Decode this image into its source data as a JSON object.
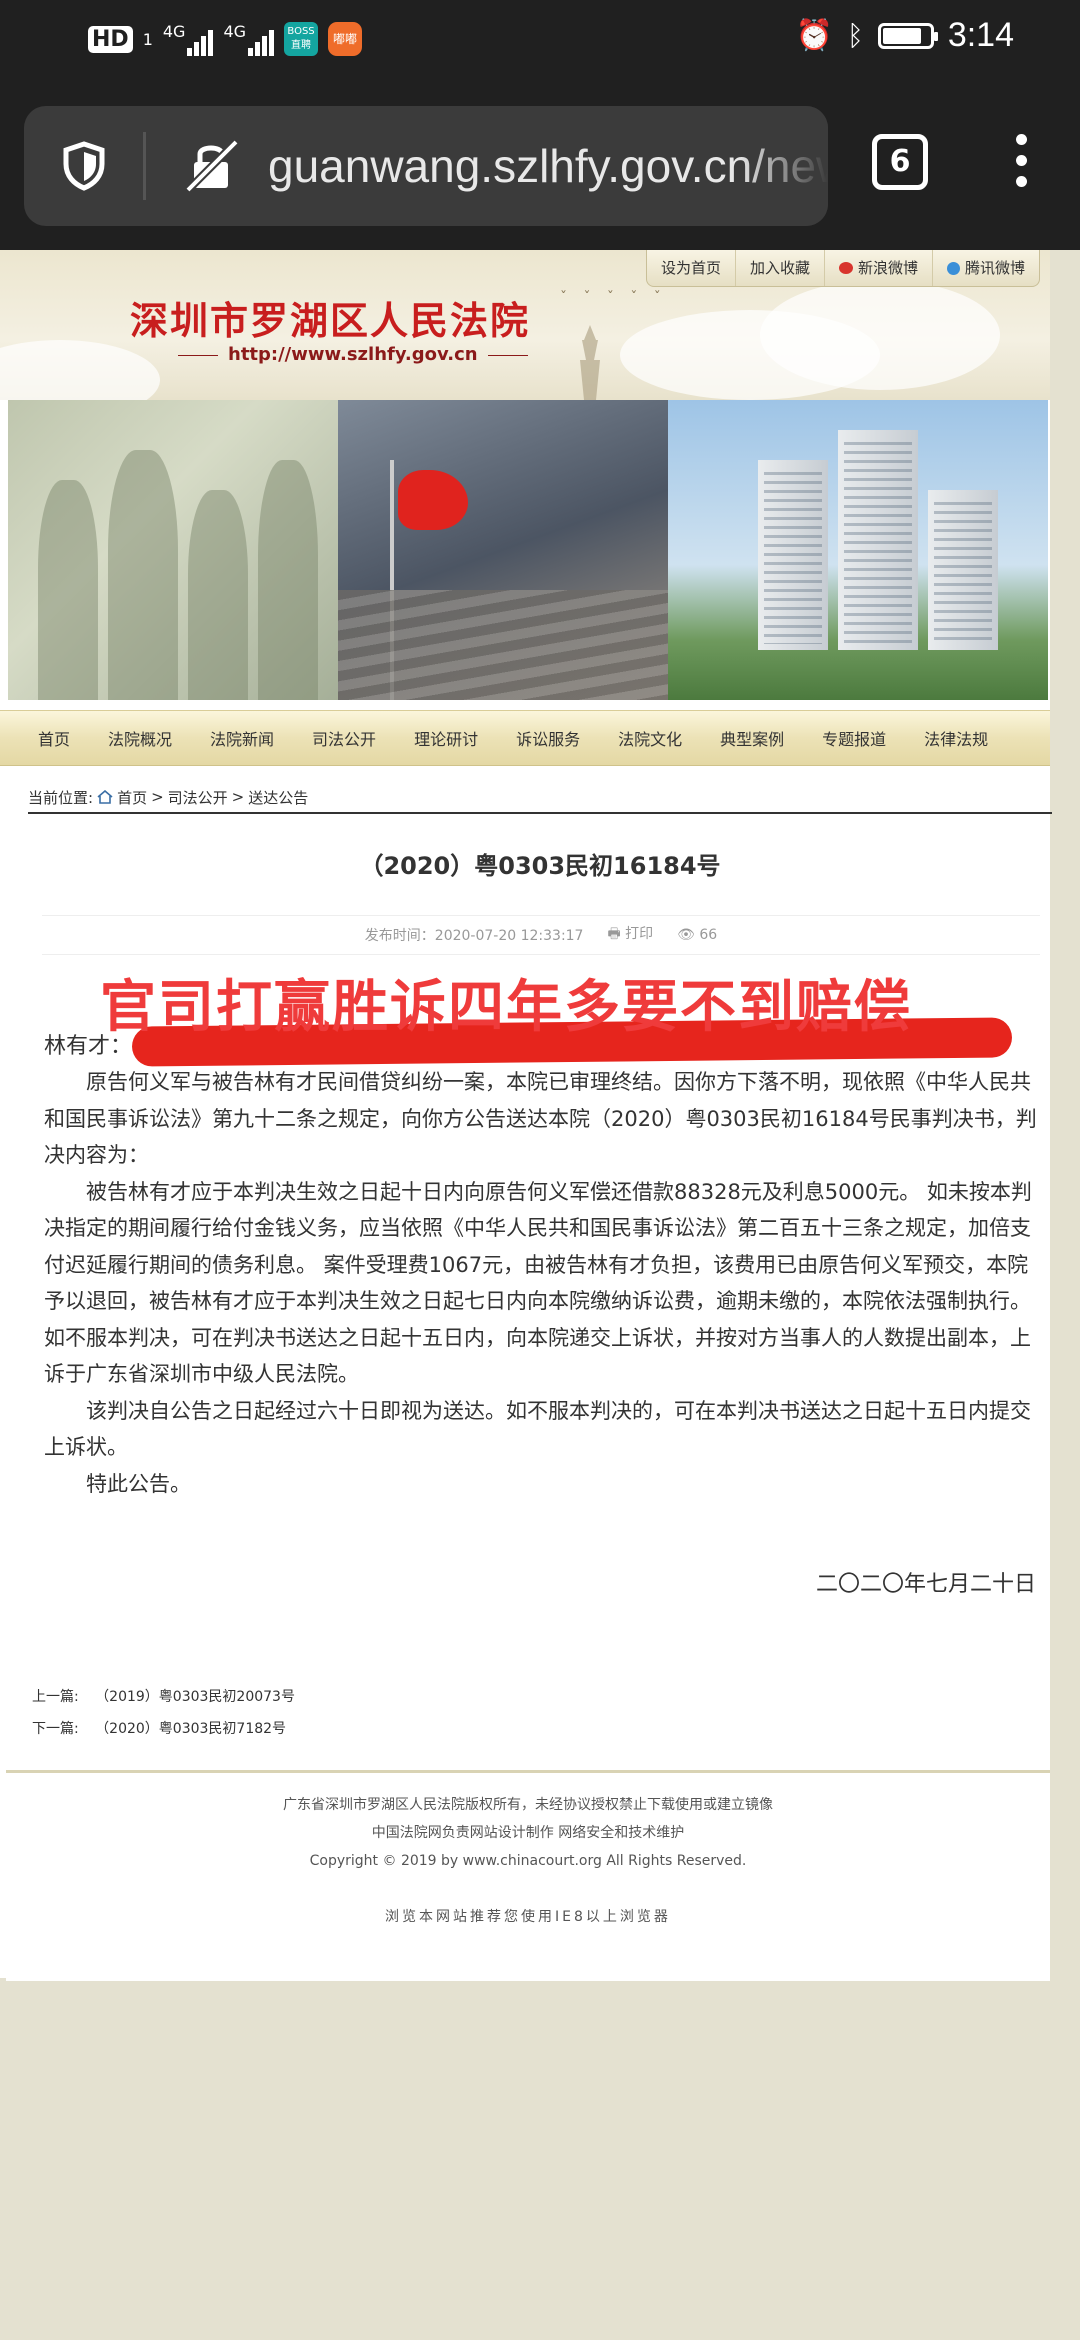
{
  "status_bar": {
    "hd_label": "HD",
    "sim1": "1",
    "net1": "4G",
    "net2": "4G",
    "app1_label": "BOSS\n直聘",
    "app2_label": "嘟嘟",
    "time": "3:14"
  },
  "browser": {
    "url": "guanwang.szlhfy.gov.cn/news",
    "tab_count": "6"
  },
  "site": {
    "top_links": [
      "设为首页",
      "加入收藏",
      "新浪微博",
      "腾讯微博"
    ],
    "court_name": "深圳市罗湖区人民法院",
    "court_url": "http://www.szlhfy.gov.cn",
    "nav": [
      "首页",
      "法院概况",
      "法院新闻",
      "司法公开",
      "理论研讨",
      "诉讼服务",
      "法院文化",
      "典型案例",
      "专题报道",
      "法律法规"
    ],
    "breadcrumb": {
      "label": "当前位置:",
      "home": "首页",
      "sep1": ">",
      "section": "司法公开",
      "sep2": ">",
      "current": "送达公告"
    }
  },
  "article": {
    "title": "（2020）粤0303民初16184号",
    "publish_time": "发布时间：2020-07-20 12:33:17",
    "print_label": "打印",
    "views": "66",
    "overlay_caption": "官司打赢胜诉四年多要不到赔偿",
    "salutation": "林有才：",
    "paragraphs": [
      "原告何义军与被告林有才民间借贷纠纷一案，本院已审理终结。因你方下落不明，现依照《中华人民共和国民事诉讼法》第九十二条之规定，向你方公告送达本院（2020）粤0303民初16184号民事判决书，判决内容为：",
      "被告林有才应于本判决生效之日起十日内向原告何义军偿还借款88328元及利息5000元。 如未按本判决指定的期间履行给付金钱义务，应当依照《中华人民共和国民事诉讼法》第二百五十三条之规定，加倍支付迟延履行期间的债务利息。 案件受理费1067元，由被告林有才负担，该费用已由原告何义军预交，本院予以退回，被告林有才应于本判决生效之日起七日内向本院缴纳诉讼费，逾期未缴的，本院依法强制执行。 如不服本判决，可在判决书送达之日起十五日内，向本院递交上诉状，并按对方当事人的人数提出副本，上诉于广东省深圳市中级人民法院。",
      "该判决自公告之日起经过六十日即视为送达。如不服本判决的，可在本判决书送达之日起十五日内提交上诉状。",
      "特此公告。"
    ],
    "date": "二〇二〇年七月二十日"
  },
  "prev_next": {
    "prev_label": "上一篇:",
    "prev_title": "（2019）粤0303民初20073号",
    "next_label": "下一篇:",
    "next_title": "（2020）粤0303民初7182号"
  },
  "footer": {
    "line1": "广东省深圳市罗湖区人民法院版权所有，未经协议授权禁止下载使用或建立镜像",
    "line2": "中国法院网负责网站设计制作 网络安全和技术维护",
    "line3": "Copyright © 2019 by www.chinacourt.org All Rights Reserved.",
    "line4": "浏览本网站推荐您使用IE8以上浏览器"
  },
  "colors": {
    "status_bg": "#202020",
    "court_red": "#c81e1e",
    "overlay_red": "#ef3b3b",
    "nav_gold": "#ece2b6"
  }
}
